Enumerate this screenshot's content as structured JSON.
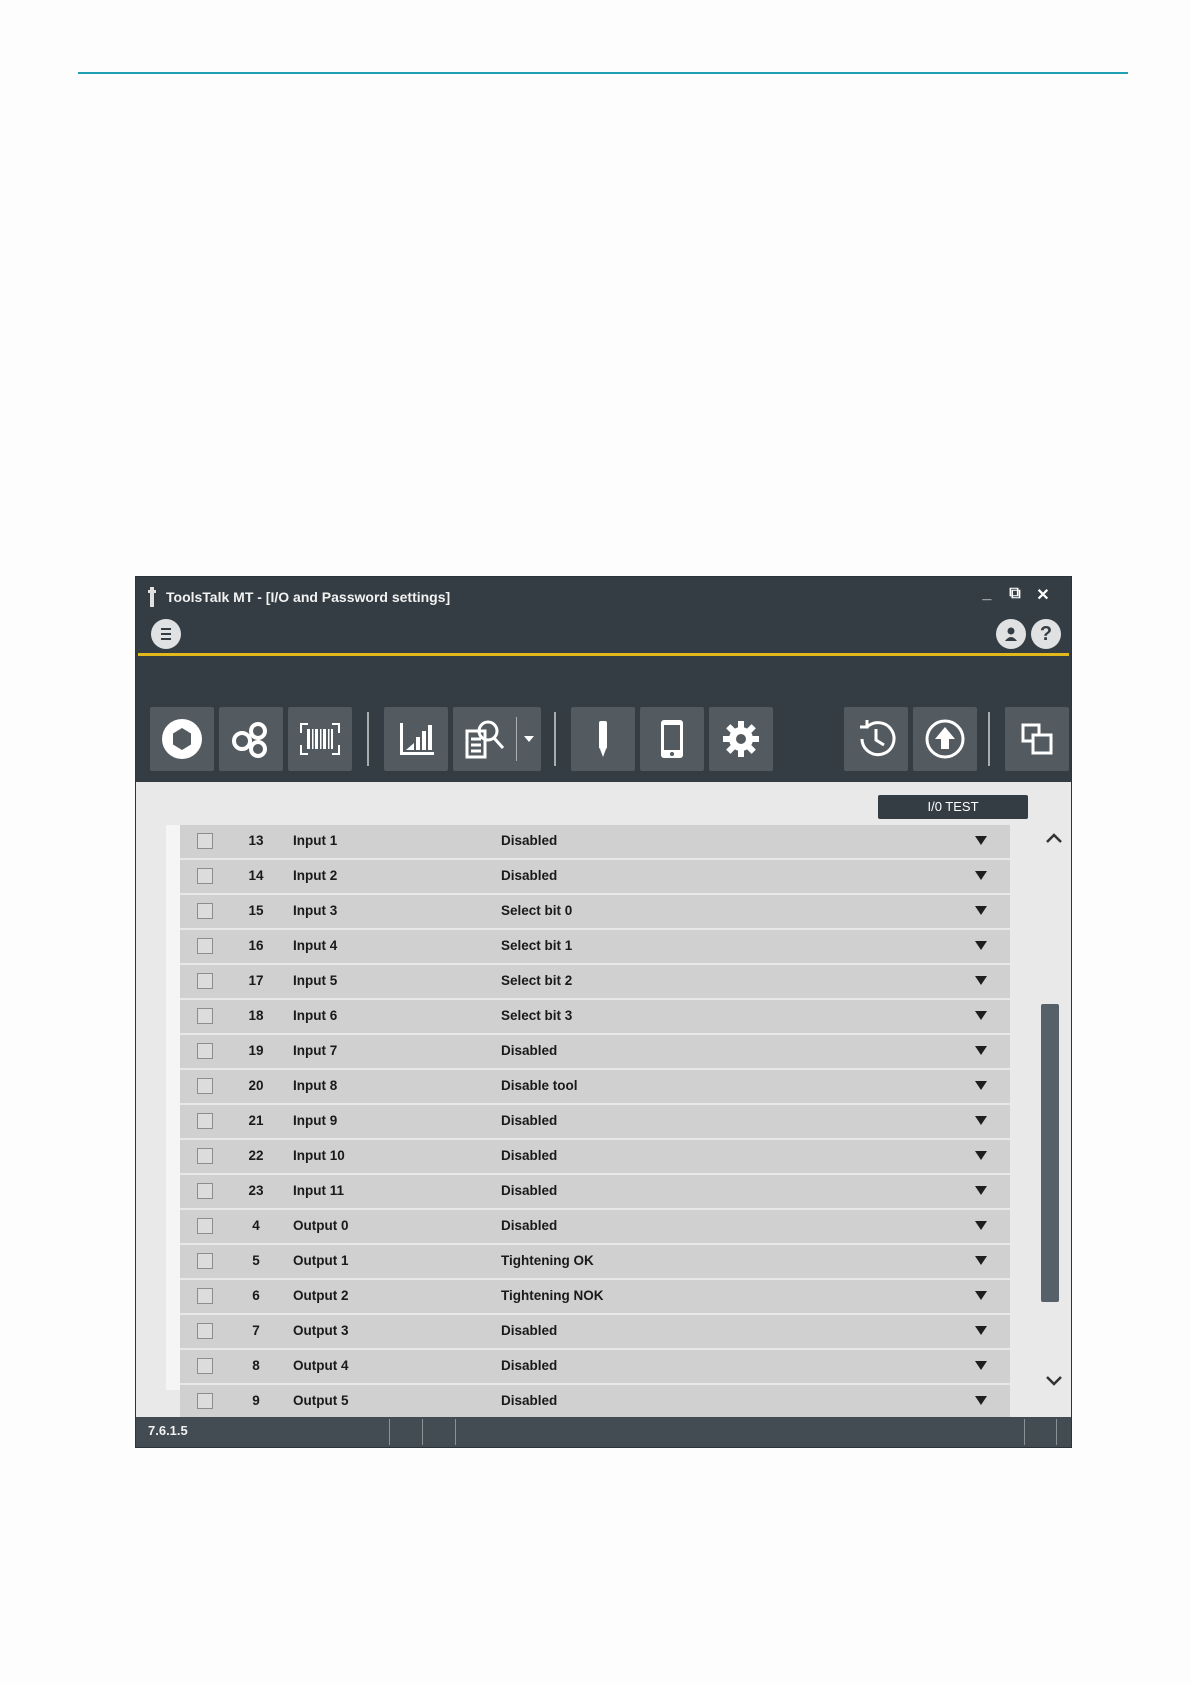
{
  "window": {
    "title": "ToolsTalk MT  - [I/O and Password settings]",
    "controls": {
      "minimize": "_",
      "restore": "⧉",
      "close": "✕"
    }
  },
  "toolbar": {
    "buttons": [
      "tightening-programs-icon",
      "multistep-icon",
      "barcode-icon",
      "results-chart-icon",
      "search-documents-icon",
      "tool-icon",
      "controller-icon",
      "settings-gear-icon",
      "history-icon",
      "upload-icon",
      "window-switch-icon"
    ]
  },
  "io_test_button": "I/0 TEST",
  "rows": [
    {
      "num": "13",
      "name": "Input 1",
      "value": "Disabled"
    },
    {
      "num": "14",
      "name": "Input 2",
      "value": "Disabled"
    },
    {
      "num": "15",
      "name": "Input 3",
      "value": "Select bit 0"
    },
    {
      "num": "16",
      "name": "Input 4",
      "value": "Select bit 1"
    },
    {
      "num": "17",
      "name": "Input 5",
      "value": "Select bit 2"
    },
    {
      "num": "18",
      "name": "Input 6",
      "value": "Select bit 3"
    },
    {
      "num": "19",
      "name": "Input 7",
      "value": "Disabled"
    },
    {
      "num": "20",
      "name": "Input 8",
      "value": "Disable tool"
    },
    {
      "num": "21",
      "name": "Input 9",
      "value": "Disabled"
    },
    {
      "num": "22",
      "name": "Input 10",
      "value": "Disabled"
    },
    {
      "num": "23",
      "name": "Input 11",
      "value": "Disabled"
    },
    {
      "num": "4",
      "name": "Output 0",
      "value": "Disabled"
    },
    {
      "num": "5",
      "name": "Output 1",
      "value": "Tightening OK"
    },
    {
      "num": "6",
      "name": "Output 2",
      "value": "Tightening NOK"
    },
    {
      "num": "7",
      "name": "Output 3",
      "value": "Disabled"
    },
    {
      "num": "8",
      "name": "Output 4",
      "value": "Disabled"
    },
    {
      "num": "9",
      "name": "Output 5",
      "value": "Disabled"
    }
  ],
  "statusbar": {
    "version": "7.6.1.5"
  },
  "colors": {
    "accent_line": "#1fa0b3",
    "title_bar": "#343d43",
    "yellow_line": "#e3b81b"
  }
}
